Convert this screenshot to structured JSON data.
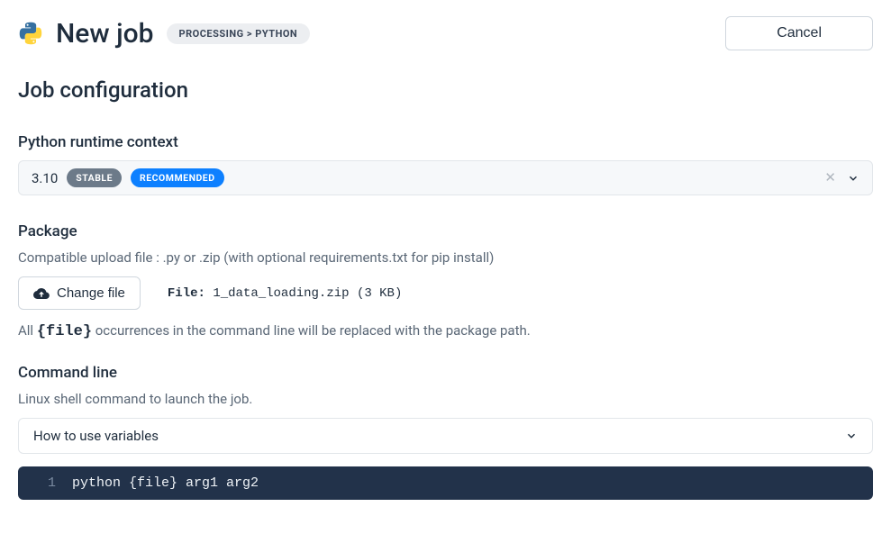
{
  "header": {
    "title": "New job",
    "breadcrumb": "PROCESSING > PYTHON",
    "cancel_label": "Cancel"
  },
  "section_title": "Job configuration",
  "runtime": {
    "label": "Python runtime context",
    "version": "3.10",
    "badge_stable": "STABLE",
    "badge_recommended": "RECOMMENDED"
  },
  "package": {
    "label": "Package",
    "help": "Compatible upload file : .py or .zip (with optional requirements.txt for pip install)",
    "change_file_label": "Change file",
    "file_prefix": "File:",
    "file_name": "1_data_loading.zip (3 KB)",
    "hint_prefix": "All ",
    "hint_code": "{file}",
    "hint_suffix": " occurrences in the command line will be replaced with the package path."
  },
  "cmd": {
    "label": "Command line",
    "help": "Linux shell command to launch the job.",
    "variables_toggle": "How to use variables",
    "line_no": "1",
    "code": "python {file} arg1 arg2"
  }
}
